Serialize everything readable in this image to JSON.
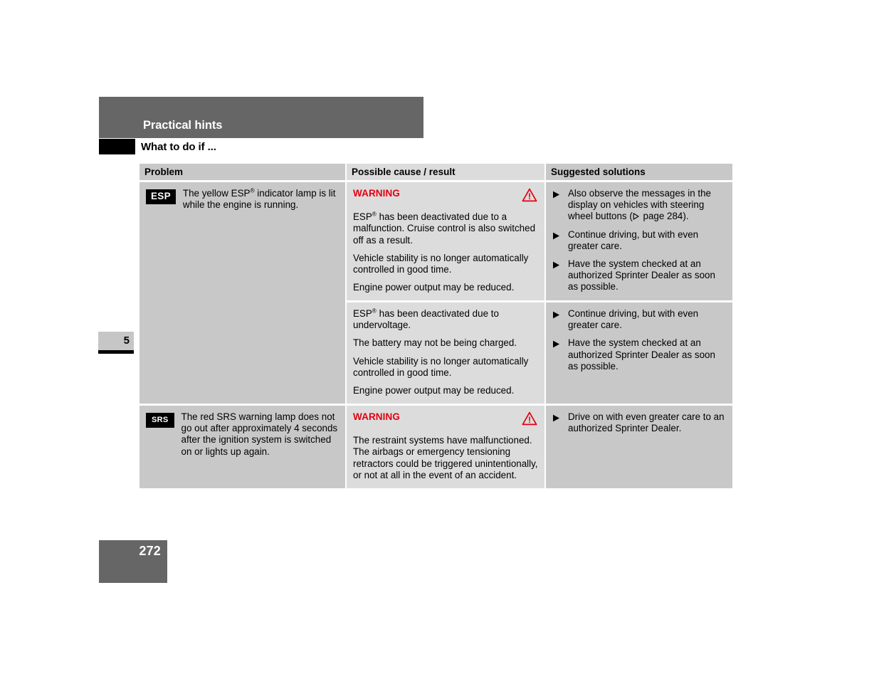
{
  "header": {
    "chapter_title": "Practical hints",
    "section_title": "What to do if ...",
    "chapter_number": "5",
    "page_number": "272"
  },
  "table": {
    "columns": [
      {
        "label": "Problem"
      },
      {
        "label": "Possible cause / result"
      },
      {
        "label": "Suggested solutions"
      }
    ],
    "rows": [
      {
        "problem": {
          "lamp_label": "ESP",
          "lamp_style": "esp",
          "text_before_reg": "The yellow ESP",
          "text_after_reg": " indicator lamp is lit while the engine is running."
        },
        "subrows": [
          {
            "warning_label": "WARNING",
            "has_warning": true,
            "cause_paragraphs": [
              "ESP® has been deactivated due to a malfunction. Cruise control is also switched off as a result.",
              "Vehicle stability is no longer automatically controlled in good time.",
              "Engine power output may be reduced."
            ],
            "solutions": [
              "Also observe the messages in the display on vehicles with steering wheel buttons (▷ page 284).",
              "Continue driving, but with even greater care.",
              "Have the system checked at an authorized Sprinter Dealer as soon as possible."
            ]
          },
          {
            "has_warning": false,
            "warning_label": "",
            "cause_paragraphs": [
              "ESP® has been deactivated due to undervoltage.",
              "The battery may not be being charged.",
              "Vehicle stability is no longer automatically controlled in good time.",
              "Engine power output may be reduced."
            ],
            "solutions": [
              "Continue driving, but with even greater care.",
              "Have the system checked at an authorized Sprinter Dealer as soon as possible."
            ]
          }
        ]
      },
      {
        "problem": {
          "lamp_label": "SRS",
          "lamp_style": "srs",
          "text_before_reg": "The red SRS warning lamp does not go out after approximately 4 seconds after the ignition system is switched on or lights up again.",
          "text_after_reg": ""
        },
        "subrows": [
          {
            "has_warning": true,
            "warning_label": "WARNING",
            "cause_paragraphs": [
              "The restraint systems have malfunctioned. The airbags or emergency tensioning retractors could be triggered unintentionally, or not at all in the event of an accident."
            ],
            "solutions": [
              "Drive on with even greater care to an authorized Sprinter Dealer."
            ]
          }
        ]
      }
    ]
  },
  "colors": {
    "band_grey": "#666666",
    "col_dark": "#c8c8c8",
    "col_light": "#dcdcdc",
    "warning_red": "#e3000f"
  },
  "icons": {
    "warning_triangle": "warning-triangle-icon",
    "bullet_triangle": "bullet-triangle-icon",
    "xref_triangle": "cross-reference-triangle-icon"
  }
}
